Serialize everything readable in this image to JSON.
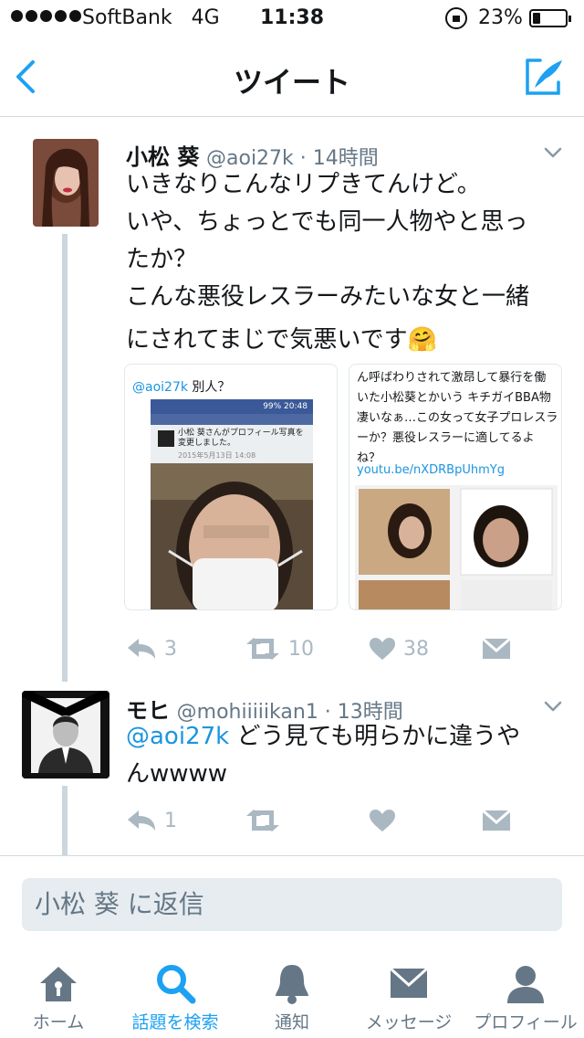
{
  "status_bar": {
    "carrier": "SoftBank",
    "network": "4G",
    "time": "11:38",
    "battery_percent": "23%",
    "battery_level": 0.23
  },
  "nav": {
    "title": "ツイート"
  },
  "tweets": [
    {
      "name": "小松 葵",
      "handle": "@aoi27k",
      "time": "14時間",
      "lines": [
        "いきなりこんなリプきてんけど。",
        "いや、ちょっとでも同一人物やと思っ",
        "たか？",
        "こんな悪役レスラーみたいな女と一緒",
        "にされてまじで気悪いです🤗"
      ],
      "actions": {
        "reply": "3",
        "retweet": "10",
        "like": "38"
      },
      "media": [
        {
          "caption_mention": "@aoi27k",
          "caption": " 別人？",
          "inner_status": "99% 20:48",
          "inner_post": "小松 葵さんがプロフィール写真を変更しました。",
          "inner_date": "2015年5月13日 14:08"
        },
        {
          "text_lines": [
            "ん呼ばわりされて激昂して暴行を働",
            "いた小松葵とかいう キチガイBBA物",
            "凄いなぁ…この女って女子プロレスラ",
            "ーか？悪役レスラーに適してるよ",
            "ね？"
          ],
          "link": "youtu.be/nXDRBpUhmYg"
        }
      ]
    },
    {
      "name": "モヒ",
      "handle": "@mohiiiiikan1",
      "time": "13時間",
      "mention": "@aoi27k",
      "text_after_mention": " どう見ても明らかに違うや",
      "line2": "んwwww",
      "actions": {
        "reply": "1",
        "retweet": "",
        "like": ""
      }
    }
  ],
  "reply": {
    "placeholder": "小松 葵 に返信"
  },
  "tabbar": {
    "items": [
      {
        "label": "ホーム",
        "icon": "home-icon"
      },
      {
        "label": "話題を検索",
        "icon": "search-icon"
      },
      {
        "label": "通知",
        "icon": "bell-icon"
      },
      {
        "label": "メッセージ",
        "icon": "mail-icon"
      },
      {
        "label": "プロフィール",
        "icon": "person-icon"
      }
    ]
  },
  "colors": {
    "accent": "#1da1f2",
    "link": "#1b95e0",
    "muted": "#657786",
    "action": "#aab8c2"
  }
}
